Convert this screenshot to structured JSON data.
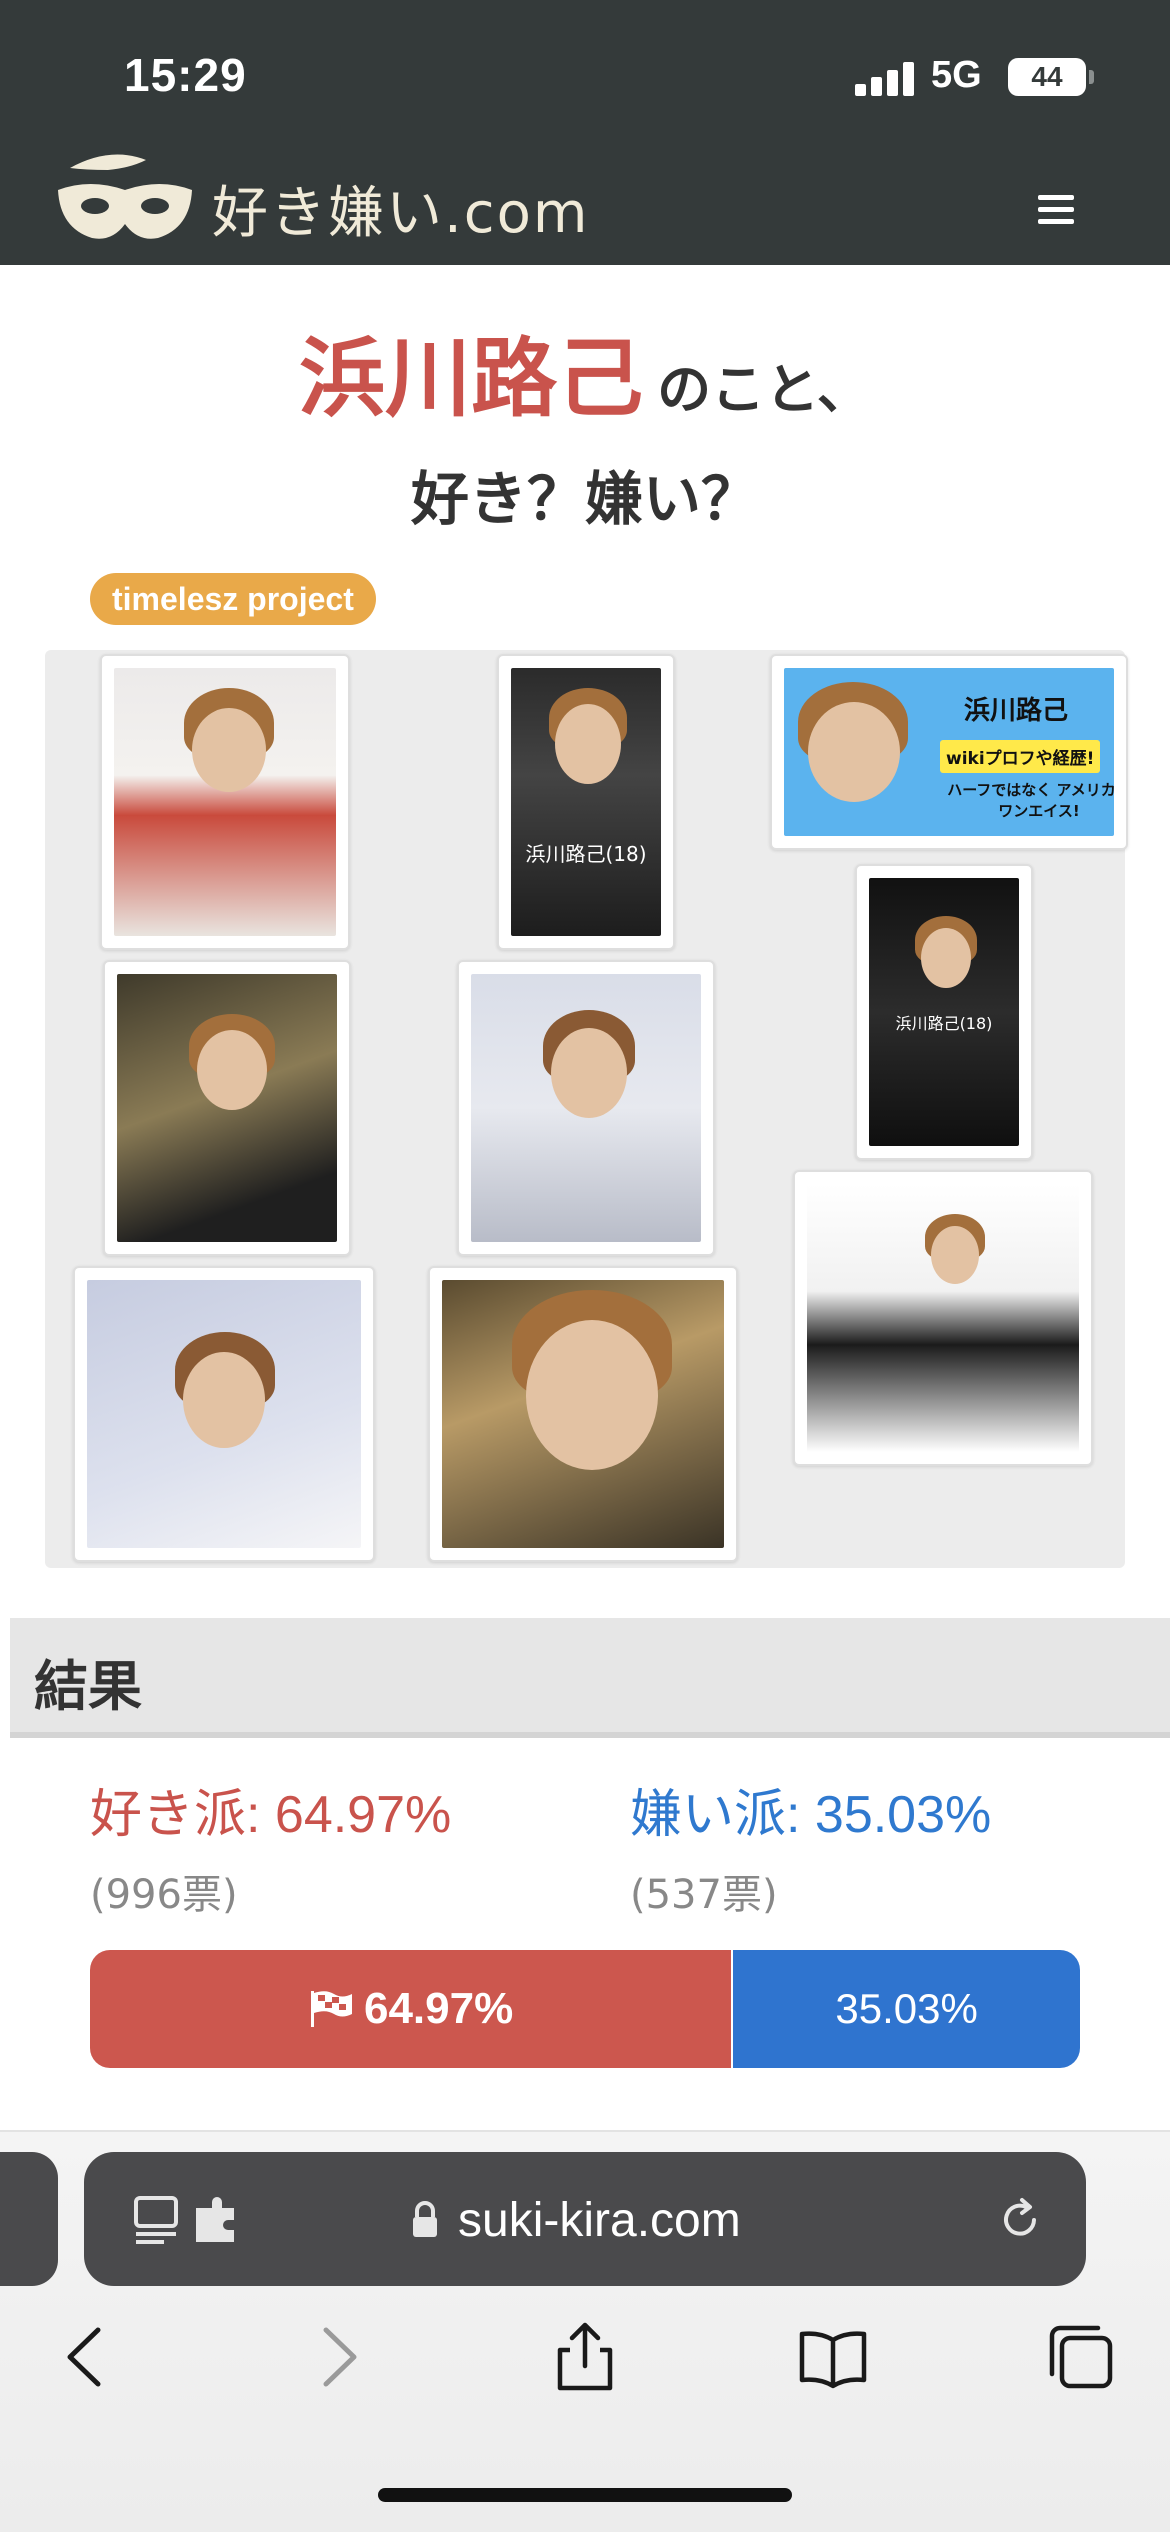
{
  "status_bar": {
    "time": "15:29",
    "network": "5G",
    "battery": "44"
  },
  "site": {
    "logo_text": "好き嫌い.com"
  },
  "page": {
    "name": "浜川路己",
    "name_suffix": "のこと、",
    "question": "好き？嫌い？",
    "tag": "timelesz project"
  },
  "collage": {
    "photo3_title": "浜川路己",
    "photo3_tag": "wikiプロフや経歴!",
    "photo3_sub": "ハーフではなく アメリカのワンエイス!",
    "photo2_caption": "浜川路己(18)",
    "photo6_caption": "浜川路己(18)"
  },
  "results": {
    "title": "結果",
    "like_label": "好き派: 64.97%",
    "dislike_label": "嫌い派: 35.03%",
    "like_votes": "(996票)",
    "dislike_votes": "(537票)",
    "like_percent": 64.97,
    "dislike_percent": 35.03,
    "like_bar_text": "64.97%",
    "dislike_bar_text": "35.03%",
    "colors": {
      "like": "#cc574e",
      "dislike": "#2f74cf"
    }
  },
  "browser": {
    "url": "suki-kira.com"
  }
}
